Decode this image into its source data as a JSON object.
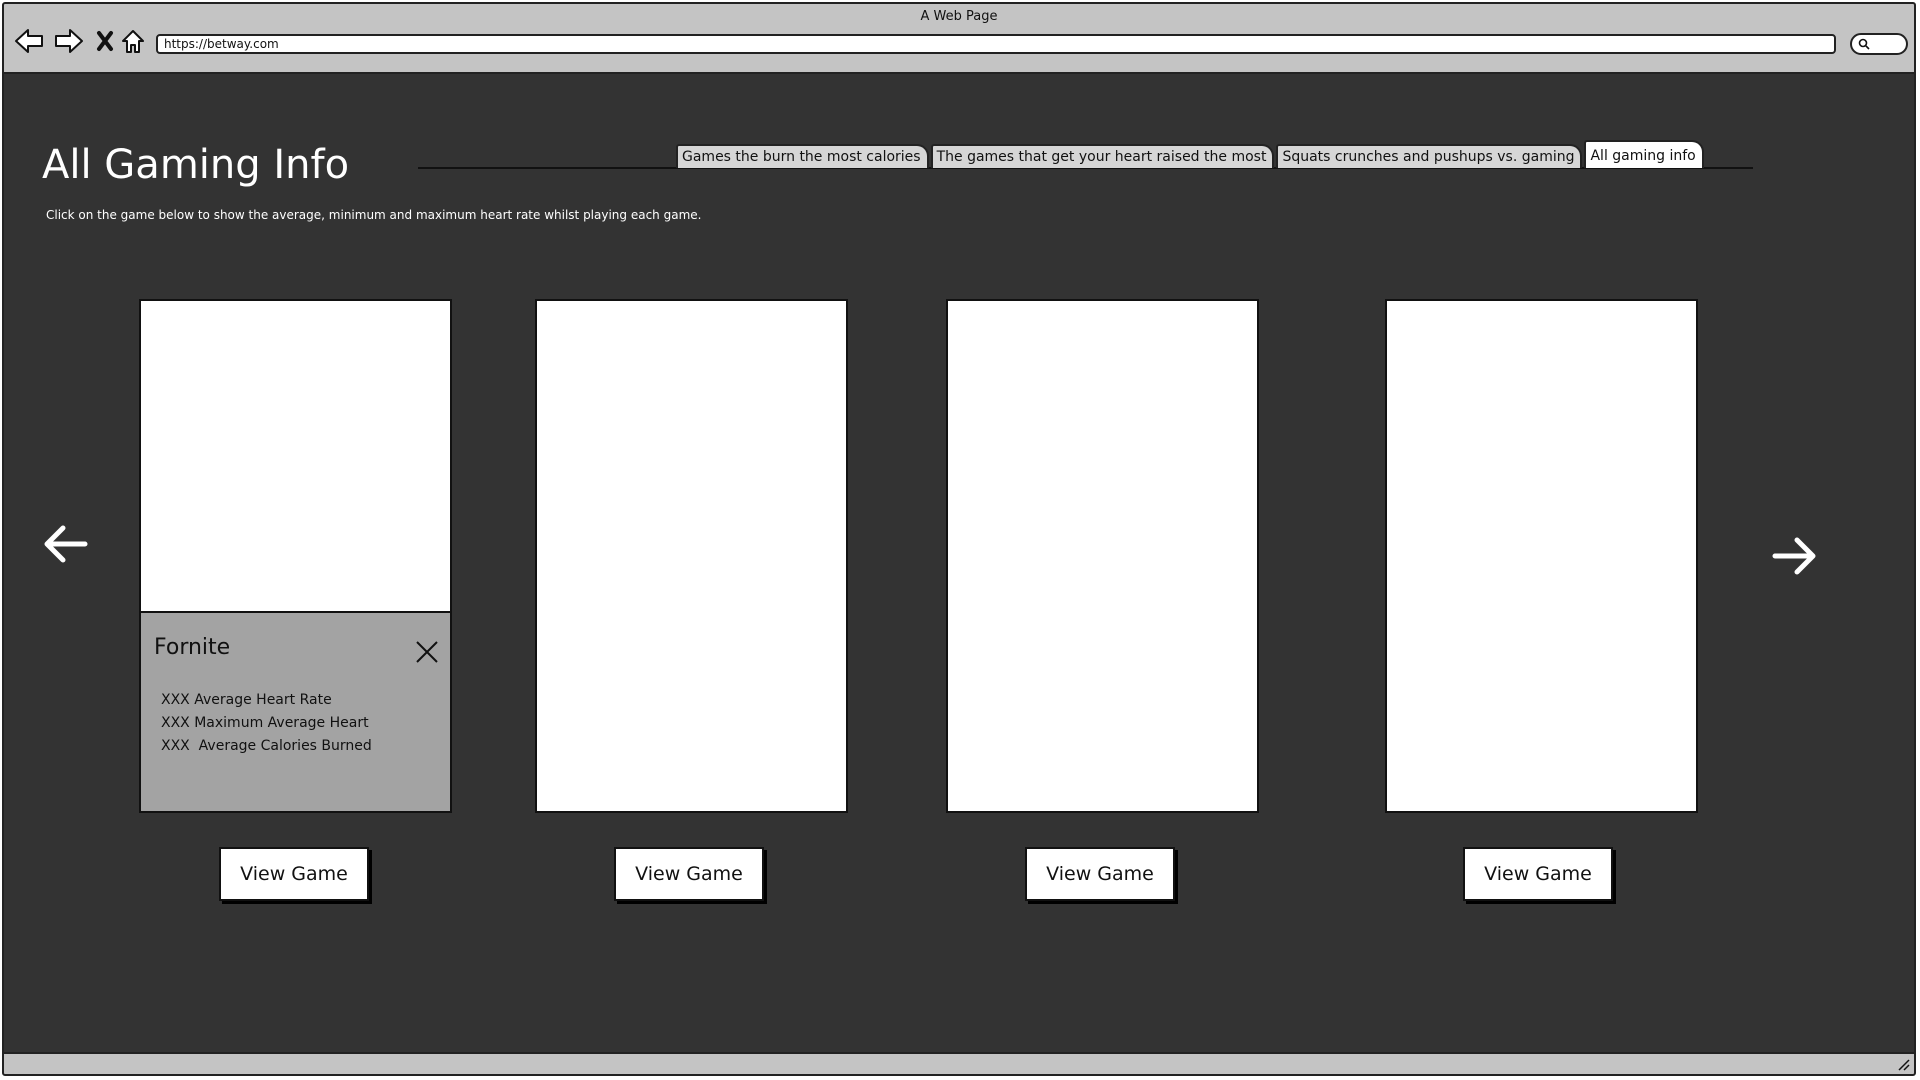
{
  "browser": {
    "window_title": "A Web Page",
    "url": "https://betway.com",
    "icons": [
      "back-arrow-icon",
      "forward-arrow-icon",
      "close-icon",
      "home-icon",
      "search-icon"
    ]
  },
  "page": {
    "title": "All Gaming Info",
    "instructions": "Click on the game below to show the average, minimum and maximum heart rate whilst playing each game."
  },
  "tabs": [
    {
      "label": "Games the burn the most calories",
      "active": false
    },
    {
      "label": "The games that get your heart raised the most",
      "active": false
    },
    {
      "label": "Squats crunches and pushups vs. gaming",
      "active": false
    },
    {
      "label": "All gaming info",
      "active": true
    }
  ],
  "carousel": {
    "prev_icon": "arrow-left-icon",
    "next_icon": "arrow-right-icon",
    "cards": [
      {
        "button_label": "View Game",
        "popup": {
          "title": "Fornite",
          "stats": [
            "XXX Average Heart Rate",
            "XXX Maximum Average Heart",
            "XXX  Average Calories Burned"
          ]
        }
      },
      {
        "button_label": "View Game"
      },
      {
        "button_label": "View Game"
      },
      {
        "button_label": "View Game"
      }
    ]
  },
  "colors": {
    "page_background": "#333333",
    "chrome": "#c4c4c4",
    "popup_background": "#a3a3a3"
  }
}
